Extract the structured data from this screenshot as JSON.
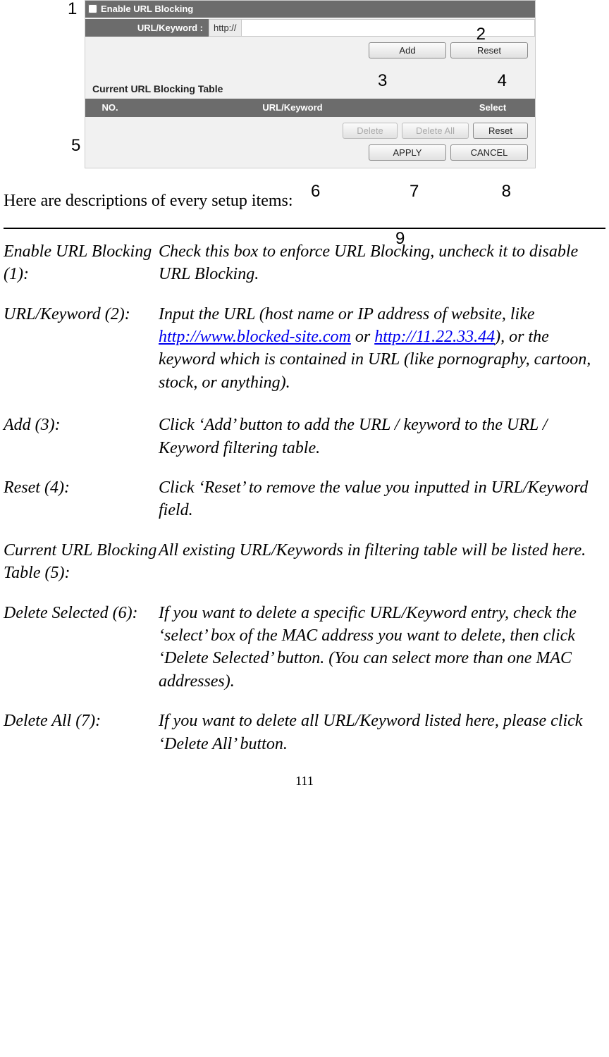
{
  "panel": {
    "enable_label": "Enable URL Blocking",
    "url_label": "URL/Keyword :",
    "url_prefix": "http://",
    "url_value": "",
    "add_btn": "Add",
    "reset1_btn": "Reset",
    "section2_title": "Current URL Blocking Table",
    "th_no": "NO.",
    "th_key": "URL/Keyword",
    "th_sel": "Select",
    "delete_btn": "Delete",
    "delete_all_btn": "Delete All",
    "reset2_btn": "Reset",
    "apply_btn": "APPLY",
    "cancel_btn": "CANCEL"
  },
  "callouts": {
    "c1": "1",
    "c2": "2",
    "c3": "3",
    "c4": "4",
    "c5": "5",
    "c6": "6",
    "c7": "7",
    "c8": "8",
    "c9": "9"
  },
  "intro": "Here are descriptions of every setup items:",
  "desc": [
    {
      "label": "Enable URL Blocking (1):",
      "body_parts": [
        {
          "t": "Check this box to enforce URL Blocking, uncheck it to disable URL Blocking."
        }
      ]
    },
    {
      "label": "URL/Keyword (2):",
      "body_parts": [
        {
          "t": "Input the URL (host name or IP address of website, like "
        },
        {
          "t": "http://www.blocked-site.com",
          "link": true
        },
        {
          "t": " or "
        },
        {
          "t": "http://11.22.33.44",
          "link": true
        },
        {
          "t": "), or the keyword which is contained in URL (like pornography, cartoon, stock, or anything)."
        }
      ]
    },
    {
      "label": "Add (3):",
      "body_parts": [
        {
          "t": "Click ‘Add’ button to add the URL / keyword to the URL / Keyword filtering table."
        }
      ]
    },
    {
      "label": "Reset (4):",
      "body_parts": [
        {
          "t": "Click ‘Reset’ to remove the value you inputted in URL/Keyword field."
        }
      ]
    },
    {
      "label": "Current URL Blocking Table (5):",
      "body_parts": [
        {
          "t": "All existing URL/Keywords in filtering table will be listed here."
        }
      ]
    },
    {
      "label": "Delete Selected (6):",
      "body_parts": [
        {
          "t": "If you want to delete a specific URL/Keyword entry, check the ‘select’ box of the MAC address you want to delete, then click ‘Delete Selected’ button. (You can select more than one MAC addresses)."
        }
      ]
    },
    {
      "label": "Delete All (7):",
      "body_parts": [
        {
          "t": "If you want to delete all URL/Keyword listed here, please click ‘Delete All’ button."
        }
      ]
    }
  ],
  "page_number": "111"
}
